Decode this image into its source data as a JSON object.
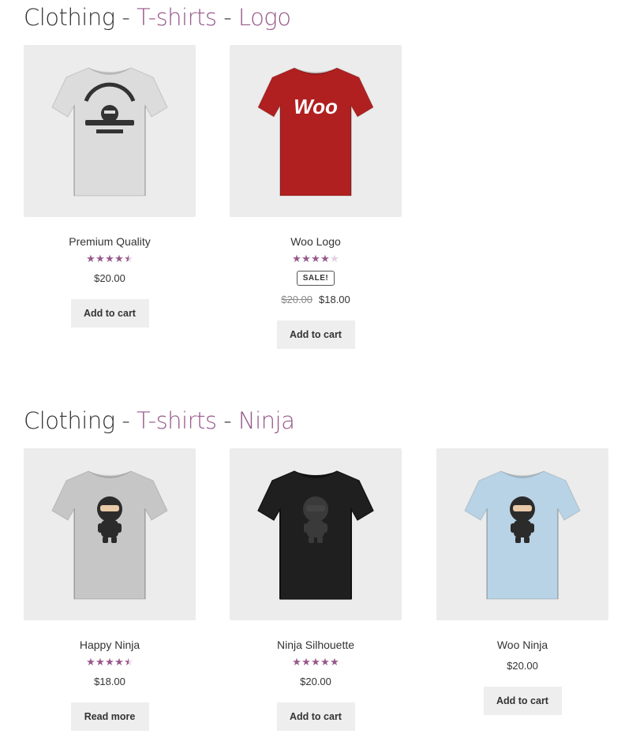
{
  "sections": [
    {
      "title": {
        "category": "Clothing",
        "separator": " - ",
        "sub1": "T-shirts",
        "sub2": "Logo"
      },
      "products": [
        {
          "name": "Premium Quality",
          "rating": 4.5,
          "sale": false,
          "sale_label": "",
          "old_price": "",
          "price": "$20.00",
          "button": "Add to cart",
          "shirt_color": "#dcdcdc",
          "graphic": "woothemes-badge-icon"
        },
        {
          "name": "Woo Logo",
          "rating": 4.0,
          "sale": true,
          "sale_label": "SALE!",
          "old_price": "$20.00",
          "price": "$18.00",
          "button": "Add to cart",
          "shirt_color": "#b02020",
          "graphic": "woo-logo-icon",
          "graphic_text": "Woo"
        }
      ]
    },
    {
      "title": {
        "category": "Clothing",
        "separator": " - ",
        "sub1": "T-shirts",
        "sub2": "Ninja"
      },
      "products": [
        {
          "name": "Happy Ninja",
          "rating": 4.5,
          "sale": false,
          "sale_label": "",
          "old_price": "",
          "price": "$18.00",
          "button": "Read more",
          "shirt_color": "#c6c6c6",
          "graphic": "ninja-icon"
        },
        {
          "name": "Ninja Silhouette",
          "rating": 5,
          "sale": false,
          "sale_label": "",
          "old_price": "",
          "price": "$20.00",
          "button": "Add to cart",
          "shirt_color": "#1f1f1f",
          "graphic": "ninja-silhouette-icon"
        },
        {
          "name": "Woo Ninja",
          "rating": 0,
          "sale": false,
          "sale_label": "",
          "old_price": "",
          "price": "$20.00",
          "button": "Add to cart",
          "shirt_color": "#b8d3e6",
          "graphic": "woo-ninja-icon"
        }
      ]
    }
  ],
  "colors": {
    "accent": "#96588a",
    "star_empty": "#e4cfe0",
    "thumb_bg": "#ececec",
    "button_bg": "#eeeeee"
  }
}
